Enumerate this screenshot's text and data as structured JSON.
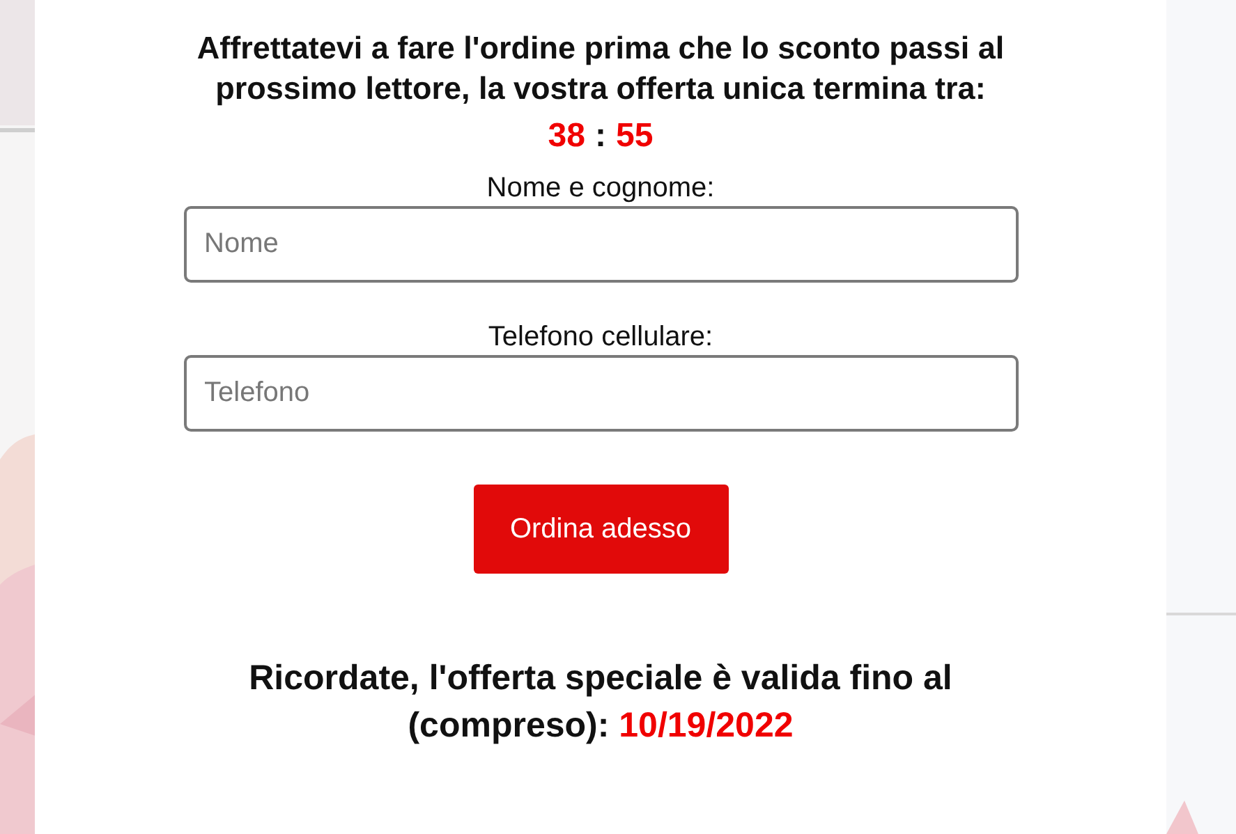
{
  "headline": "Affrettatevi a fare l'ordine prima che lo sconto passi al prossimo lettore, la vostra offerta unica termina tra:",
  "countdown": {
    "minutes": "38",
    "separator": ":",
    "seconds": "55"
  },
  "fields": [
    {
      "label": "Nome e cognome:",
      "placeholder": "Nome"
    },
    {
      "label": "Telefono cellulare:",
      "placeholder": "Telefono"
    }
  ],
  "submit_button": "Ordina adesso",
  "reminder": {
    "text": "Ricordate, l'offerta speciale è valida fino al (compreso):",
    "date": "10/19/2022"
  }
}
